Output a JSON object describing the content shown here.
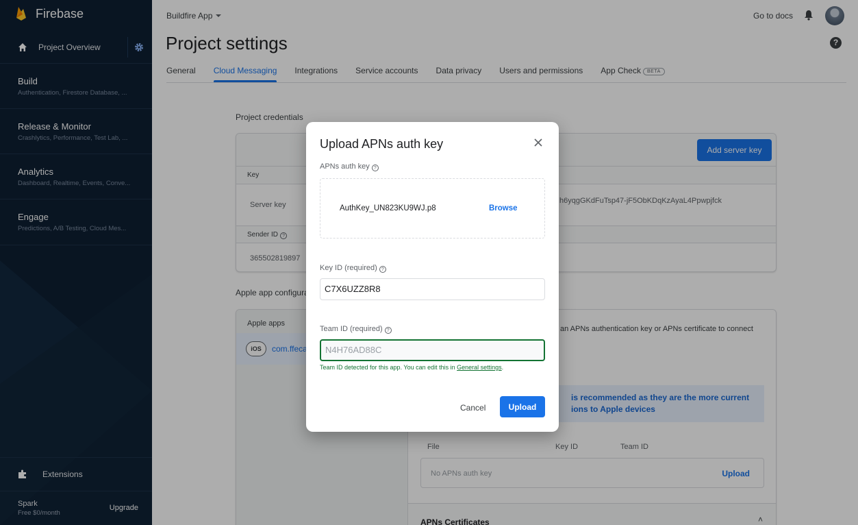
{
  "sidebar": {
    "brand": "Firebase",
    "project_overview": "Project Overview",
    "sections": [
      {
        "title": "Build",
        "subtitle": "Authentication, Firestore Database, ..."
      },
      {
        "title": "Release & Monitor",
        "subtitle": "Crashlytics, Performance, Test Lab, ..."
      },
      {
        "title": "Analytics",
        "subtitle": "Dashboard, Realtime, Events, Conve..."
      },
      {
        "title": "Engage",
        "subtitle": "Predictions, A/B Testing, Cloud Mes..."
      }
    ],
    "extensions": "Extensions",
    "plan": {
      "name": "Spark",
      "price": "Free $0/month",
      "upgrade": "Upgrade"
    },
    "bg_color": "#0e1f33"
  },
  "header": {
    "app_selector": "Buildfire App",
    "go_to_docs": "Go to docs"
  },
  "page": {
    "title": "Project settings",
    "tabs": [
      {
        "label": "General"
      },
      {
        "label": "Cloud Messaging",
        "active": true
      },
      {
        "label": "Integrations"
      },
      {
        "label": "Service accounts"
      },
      {
        "label": "Data privacy"
      },
      {
        "label": "Users and permissions"
      },
      {
        "label": "App Check",
        "badge": "BETA"
      }
    ]
  },
  "content": {
    "project_credentials": "Project credentials",
    "add_server_key": "Add server key",
    "key_header": "Key",
    "server_key_label": "Server key",
    "server_key_value": "h6yqgGKdFuTsp47-jF5ObKDqKzAyaL4Ppwpjfck",
    "sender_id_header": "Sender ID",
    "sender_id_value": "365502819897",
    "apple_config_label": "Apple app configura",
    "apple_apps_header": "Apple apps",
    "ios_badge": "iOS",
    "app_name": "com.ffeca",
    "apns_text": "an APNs authentication key or APNs certificate to connect",
    "recommend_line1": "is recommended as they are the more current",
    "recommend_line2": "ions to Apple devices",
    "file_col": "File",
    "key_id_col": "Key ID",
    "team_id_col": "Team ID",
    "no_key": "No APNs auth key",
    "upload_link": "Upload",
    "apns_certificates": "APNs Certificates"
  },
  "modal": {
    "title": "Upload APNs auth key",
    "auth_key_label": "APNs auth key",
    "file_name": "AuthKey_UN823KU9WJ.p8",
    "browse": "Browse",
    "key_id_label": "Key ID (required)",
    "key_id_value": "C7X6UZZ8R8",
    "team_id_label": "Team ID (required)",
    "team_id_value": "N4H76AD88C",
    "team_hint_prefix": "Team ID detected for this app. You can edit this in ",
    "team_hint_link": "General settings",
    "team_hint_suffix": ".",
    "cancel": "Cancel",
    "upload": "Upload"
  },
  "colors": {
    "accent": "#1a73e8",
    "success": "#137333"
  }
}
